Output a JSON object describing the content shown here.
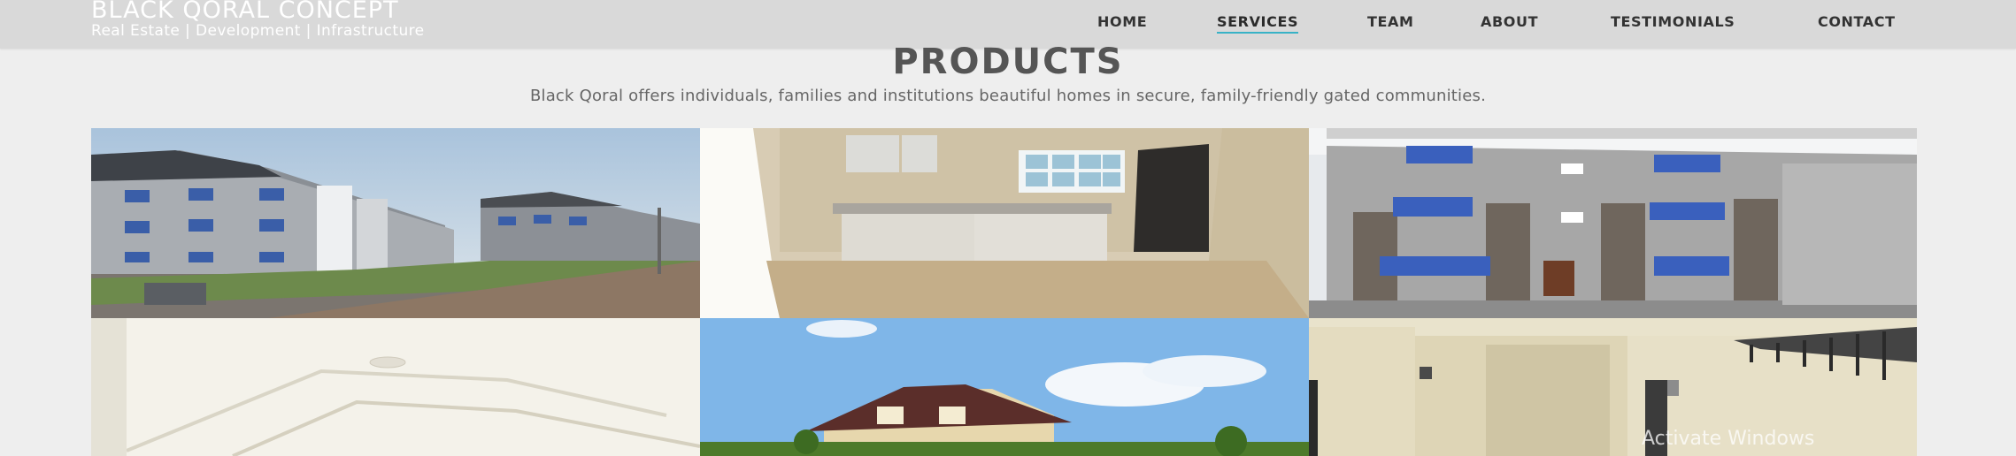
{
  "brand": {
    "title": "BLACK QORAL CONCEPT",
    "tagline": "Real Estate | Development | Infrastructure"
  },
  "nav": {
    "items": [
      {
        "label": "HOME"
      },
      {
        "label": "SERVICES",
        "active": true
      },
      {
        "label": "TEAM"
      },
      {
        "label": "ABOUT"
      },
      {
        "label": "TESTIMONIALS"
      },
      {
        "label": "CONTACT"
      }
    ],
    "accent_color": "#38b2c6"
  },
  "section": {
    "title": "PRODUCTS",
    "description": "Black Qoral offers individuals, families and institutions beautiful homes in secure, family-friendly gated communities."
  },
  "gallery": {
    "photos": [
      {
        "subject": "estate-street-photo"
      },
      {
        "subject": "kitchen-interior-photo"
      },
      {
        "subject": "terrace-building-photo"
      },
      {
        "subject": "ceiling-interior-photo"
      },
      {
        "subject": "duplex-house-photo"
      },
      {
        "subject": "staircase-interior-photo"
      }
    ]
  },
  "os_watermark": "Activate Windows"
}
